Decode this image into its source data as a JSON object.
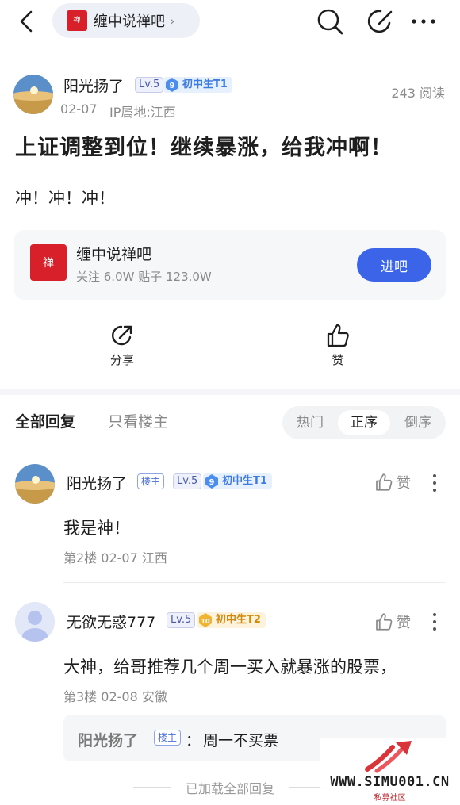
{
  "header": {
    "forum_name": "缠中说禅吧",
    "forum_logo_text": "说禅缠中",
    "icons": [
      "back-icon",
      "search-icon",
      "edit-icon",
      "more-icon"
    ]
  },
  "post": {
    "author": "阳光扬了",
    "level": "Lv.5",
    "title_badge_num": "9",
    "title_badge": "初中生T1",
    "date": "02-07",
    "ip": "IP属地:江西",
    "reads": "243 阅读",
    "title": "上证调整到位！继续暴涨，给我冲啊！",
    "body": "冲！冲！冲！"
  },
  "forum_card": {
    "name": "缠中说禅吧",
    "stats": "关注 6.0W  贴子 123.0W",
    "enter_label": "进吧"
  },
  "actions": {
    "share": "分享",
    "like": "赞"
  },
  "tabs": {
    "all": "全部回复",
    "owner_only": "只看楼主"
  },
  "sort": [
    "热门",
    "正序",
    "倒序"
  ],
  "sort_active": "正序",
  "comments": [
    {
      "name": "阳光扬了",
      "owner_tag": "楼主",
      "level": "Lv.5",
      "badge_num": "9",
      "badge": "初中生T1",
      "like": "赞",
      "text": "我是神！",
      "meta": "第2楼  02-07  江西"
    },
    {
      "name": "无欲无惑777",
      "level": "Lv.5",
      "badge_num": "10",
      "badge": "初中生T2",
      "like": "赞",
      "text": "大神，给哥推荐几个周一买入就暴涨的股票，",
      "meta": "第3楼  02-08  安徽",
      "reply": {
        "author": "阳光扬了",
        "tag": "楼主",
        "colon": "：",
        "text": "周一不买票"
      }
    }
  ],
  "footer": {
    "loaded": "已加载全部回复"
  },
  "watermark": {
    "url": "WWW.SIMU001.CN",
    "sub": "私募社区"
  },
  "colors": {
    "accent": "#3b64e8",
    "forum_red": "#d8202a",
    "muted": "#8a8a8a"
  }
}
